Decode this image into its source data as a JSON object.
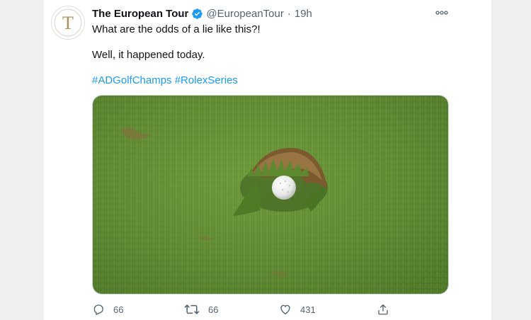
{
  "tweet": {
    "author_name": "The European Tour",
    "handle": "@EuropeanTour",
    "separator": "·",
    "time": "19h",
    "line1": "What are the odds of a lie like this?!",
    "line2": "Well, it happened today.",
    "hashtags": [
      "#ADGolfChamps",
      "#RolexSeries"
    ],
    "avatar_letter": "T"
  },
  "actions": {
    "reply_count": "66",
    "retweet_count": "66",
    "like_count": "431"
  },
  "icons": {
    "verified": "verified-badge-icon",
    "more": "more-options-icon",
    "reply": "reply-icon",
    "retweet": "retweet-icon",
    "like": "heart-icon",
    "share": "share-icon"
  },
  "colors": {
    "accent": "#1d9bf0",
    "text": "#0f1419",
    "secondary": "#536471",
    "avatar_gold": "#b08d57"
  }
}
